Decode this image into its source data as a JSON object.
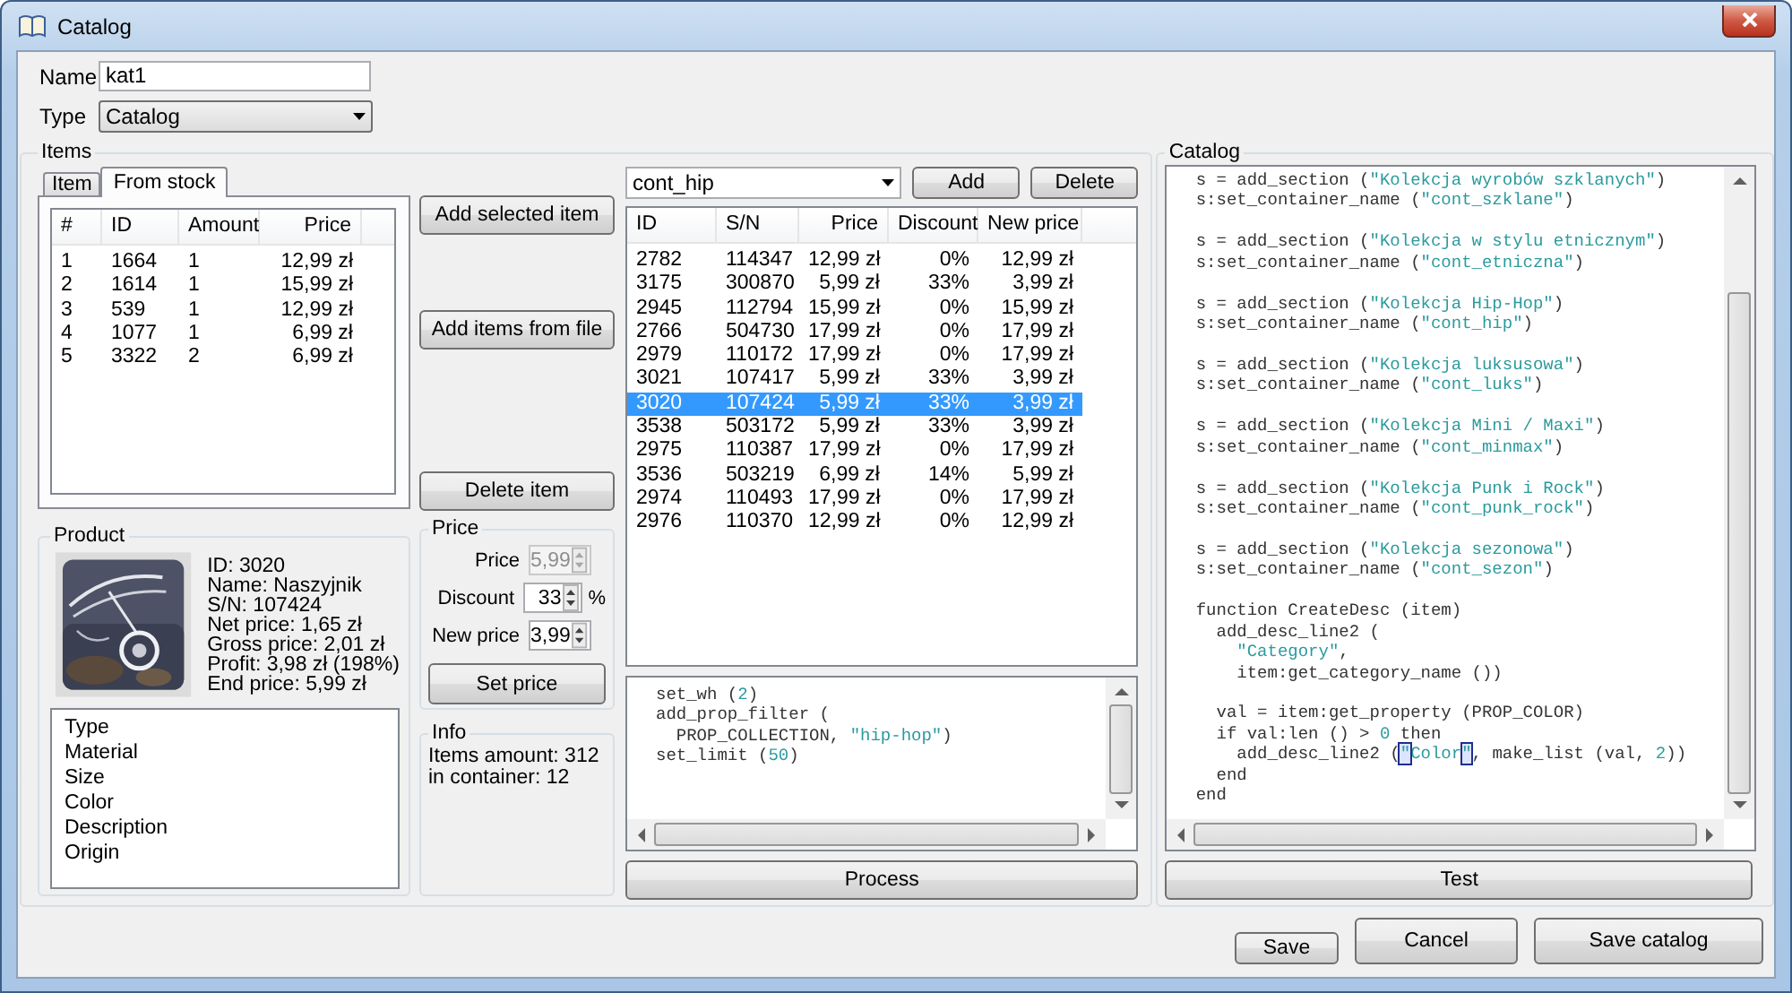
{
  "window": {
    "title": "Catalog"
  },
  "name_field": {
    "label": "Name",
    "value": "kat1"
  },
  "type_field": {
    "label": "Type",
    "value": "Catalog"
  },
  "items": {
    "title": "Items",
    "tabs": [
      {
        "label": "Item",
        "selected": false
      },
      {
        "label": "From stock",
        "selected": true
      }
    ],
    "stock_table": {
      "columns": [
        "#",
        "ID",
        "Amount",
        "Price"
      ],
      "rows": [
        [
          "1",
          "1664",
          "1",
          "12,99 zł"
        ],
        [
          "2",
          "1614",
          "1",
          "15,99 zł"
        ],
        [
          "3",
          "539",
          "1",
          "12,99 zł"
        ],
        [
          "4",
          "1077",
          "1",
          "6,99 zł"
        ],
        [
          "5",
          "3322",
          "2",
          "6,99 zł"
        ]
      ]
    },
    "buttons": [
      "Add selected item",
      "Add items from file",
      "Delete item"
    ],
    "product": {
      "title": "Product",
      "details": [
        "ID: 3020",
        "Name: Naszyjnik",
        "S/N: 107424",
        "Net price: 1,65 zł",
        "Gross price: 2,01 zł",
        "Profit: 3,98 zł (198%)",
        "End price: 5,99 zł"
      ],
      "properties": [
        "Type",
        "Material",
        "Size",
        "Color",
        "Description",
        "Origin"
      ]
    },
    "price": {
      "title": "Price",
      "fields": [
        {
          "label": "Price",
          "value": "5,99",
          "disabled": true
        },
        {
          "label": "Discount",
          "value": "33",
          "unit": "%",
          "disabled": false
        },
        {
          "label": "New price",
          "value": "3,99",
          "disabled": false
        }
      ],
      "button": "Set price"
    },
    "info": {
      "title": "Info",
      "lines": [
        "Items amount: 312",
        "in container: 12"
      ]
    },
    "container": {
      "value": "cont_hip",
      "buttons": [
        "Add",
        "Delete"
      ],
      "columns": [
        "ID",
        "S/N",
        "Price",
        "Discount",
        "New price"
      ],
      "rows": [
        {
          "cells": [
            "2782",
            "114347",
            "12,99 zł",
            "0%",
            "12,99 zł"
          ],
          "selected": false
        },
        {
          "cells": [
            "3175",
            "300870",
            "5,99 zł",
            "33%",
            "3,99 zł"
          ],
          "selected": false
        },
        {
          "cells": [
            "2945",
            "112794",
            "15,99 zł",
            "0%",
            "15,99 zł"
          ],
          "selected": false
        },
        {
          "cells": [
            "2766",
            "504730",
            "17,99 zł",
            "0%",
            "17,99 zł"
          ],
          "selected": false
        },
        {
          "cells": [
            "2979",
            "110172",
            "17,99 zł",
            "0%",
            "17,99 zł"
          ],
          "selected": false
        },
        {
          "cells": [
            "3021",
            "107417",
            "5,99 zł",
            "33%",
            "3,99 zł"
          ],
          "selected": false
        },
        {
          "cells": [
            "3020",
            "107424",
            "5,99 zł",
            "33%",
            "3,99 zł"
          ],
          "selected": true
        },
        {
          "cells": [
            "3538",
            "503172",
            "5,99 zł",
            "33%",
            "3,99 zł"
          ],
          "selected": false
        },
        {
          "cells": [
            "2975",
            "110387",
            "17,99 zł",
            "0%",
            "17,99 zł"
          ],
          "selected": false
        },
        {
          "cells": [
            "3536",
            "503219",
            "6,99 zł",
            "14%",
            "5,99 zł"
          ],
          "selected": false
        },
        {
          "cells": [
            "2974",
            "110493",
            "17,99 zł",
            "0%",
            "17,99 zł"
          ],
          "selected": false
        },
        {
          "cells": [
            "2976",
            "110370",
            "12,99 zł",
            "0%",
            "12,99 zł"
          ],
          "selected": false
        }
      ]
    },
    "filter_code": [
      {
        "kind": "code",
        "segments": [
          {
            "kind": "plain",
            "text": "set_wh ("
          },
          {
            "kind": "number",
            "text": "2"
          },
          {
            "kind": "plain",
            "text": ")"
          }
        ]
      },
      {
        "kind": "code",
        "segments": [
          {
            "kind": "plain",
            "text": "add_prop_filter ("
          }
        ]
      },
      {
        "kind": "code",
        "segments": [
          {
            "kind": "plain",
            "text": "  PROP_COLLECTION, "
          },
          {
            "kind": "string",
            "text": "\"hip-hop\""
          },
          {
            "kind": "plain",
            "text": ")"
          }
        ]
      },
      {
        "kind": "code",
        "segments": [
          {
            "kind": "plain",
            "text": "set_limit ("
          },
          {
            "kind": "number",
            "text": "50"
          },
          {
            "kind": "plain",
            "text": ")"
          }
        ]
      }
    ],
    "process_button": "Process"
  },
  "catalog": {
    "title": "Catalog",
    "code": [
      {
        "kind": "code",
        "segments": [
          {
            "kind": "plain",
            "text": "s = add_section ("
          },
          {
            "kind": "string",
            "text": "\"Kolekcja wyrobów szklanych\""
          },
          {
            "kind": "plain",
            "text": ")"
          }
        ]
      },
      {
        "kind": "code",
        "segments": [
          {
            "kind": "plain",
            "text": "s:set_container_name ("
          },
          {
            "kind": "string",
            "text": "\"cont_szklane\""
          },
          {
            "kind": "plain",
            "text": ")"
          }
        ]
      },
      {
        "kind": "blank"
      },
      {
        "kind": "code",
        "segments": [
          {
            "kind": "plain",
            "text": "s = add_section ("
          },
          {
            "kind": "string",
            "text": "\"Kolekcja w stylu etnicznym\""
          },
          {
            "kind": "plain",
            "text": ")"
          }
        ]
      },
      {
        "kind": "code",
        "segments": [
          {
            "kind": "plain",
            "text": "s:set_container_name ("
          },
          {
            "kind": "string",
            "text": "\"cont_etniczna\""
          },
          {
            "kind": "plain",
            "text": ")"
          }
        ]
      },
      {
        "kind": "blank"
      },
      {
        "kind": "code",
        "segments": [
          {
            "kind": "plain",
            "text": "s = add_section ("
          },
          {
            "kind": "string",
            "text": "\"Kolekcja Hip-Hop\""
          },
          {
            "kind": "plain",
            "text": ")"
          }
        ]
      },
      {
        "kind": "code",
        "segments": [
          {
            "kind": "plain",
            "text": "s:set_container_name ("
          },
          {
            "kind": "string",
            "text": "\"cont_hip\""
          },
          {
            "kind": "plain",
            "text": ")"
          }
        ]
      },
      {
        "kind": "blank"
      },
      {
        "kind": "code",
        "segments": [
          {
            "kind": "plain",
            "text": "s = add_section ("
          },
          {
            "kind": "string",
            "text": "\"Kolekcja luksusowa\""
          },
          {
            "kind": "plain",
            "text": ")"
          }
        ]
      },
      {
        "kind": "code",
        "segments": [
          {
            "kind": "plain",
            "text": "s:set_container_name ("
          },
          {
            "kind": "string",
            "text": "\"cont_luks\""
          },
          {
            "kind": "plain",
            "text": ")"
          }
        ]
      },
      {
        "kind": "blank"
      },
      {
        "kind": "code",
        "segments": [
          {
            "kind": "plain",
            "text": "s = add_section ("
          },
          {
            "kind": "string",
            "text": "\"Kolekcja Mini / Maxi\""
          },
          {
            "kind": "plain",
            "text": ")"
          }
        ]
      },
      {
        "kind": "code",
        "segments": [
          {
            "kind": "plain",
            "text": "s:set_container_name ("
          },
          {
            "kind": "string",
            "text": "\"cont_minmax\""
          },
          {
            "kind": "plain",
            "text": ")"
          }
        ]
      },
      {
        "kind": "blank"
      },
      {
        "kind": "code",
        "segments": [
          {
            "kind": "plain",
            "text": "s = add_section ("
          },
          {
            "kind": "string",
            "text": "\"Kolekcja Punk i Rock\""
          },
          {
            "kind": "plain",
            "text": ")"
          }
        ]
      },
      {
        "kind": "code",
        "segments": [
          {
            "kind": "plain",
            "text": "s:set_container_name ("
          },
          {
            "kind": "string",
            "text": "\"cont_punk_rock\""
          },
          {
            "kind": "plain",
            "text": ")"
          }
        ]
      },
      {
        "kind": "blank"
      },
      {
        "kind": "code",
        "segments": [
          {
            "kind": "plain",
            "text": "s = add_section ("
          },
          {
            "kind": "string",
            "text": "\"Kolekcja sezonowa\""
          },
          {
            "kind": "plain",
            "text": ")"
          }
        ]
      },
      {
        "kind": "code",
        "segments": [
          {
            "kind": "plain",
            "text": "s:set_container_name ("
          },
          {
            "kind": "string",
            "text": "\"cont_sezon\""
          },
          {
            "kind": "plain",
            "text": ")"
          }
        ]
      },
      {
        "kind": "blank"
      },
      {
        "kind": "code",
        "segments": [
          {
            "kind": "plain",
            "text": "function CreateDesc (item)"
          }
        ]
      },
      {
        "kind": "code",
        "segments": [
          {
            "kind": "plain",
            "text": "  add_desc_line2 ("
          }
        ]
      },
      {
        "kind": "code",
        "segments": [
          {
            "kind": "string",
            "text": "    \"Category\""
          },
          {
            "kind": "plain",
            "text": ","
          }
        ]
      },
      {
        "kind": "code",
        "segments": [
          {
            "kind": "plain",
            "text": "    item:get_category_name ())"
          }
        ]
      },
      {
        "kind": "blank"
      },
      {
        "kind": "code",
        "segments": [
          {
            "kind": "plain",
            "text": "  val = item:get_property (PROP_COLOR)"
          }
        ]
      },
      {
        "kind": "code",
        "segments": [
          {
            "kind": "plain",
            "text": "  if val:len () > "
          },
          {
            "kind": "number",
            "text": "0"
          },
          {
            "kind": "plain",
            "text": " then"
          }
        ]
      },
      {
        "kind": "code",
        "segments": [
          {
            "kind": "plain",
            "text": "    add_desc_line2 ("
          },
          {
            "kind": "match",
            "text": "\""
          },
          {
            "kind": "string",
            "text": "Color"
          },
          {
            "kind": "match",
            "text": "\""
          },
          {
            "kind": "plain",
            "text": ", make_list (val, "
          },
          {
            "kind": "number",
            "text": "2"
          },
          {
            "kind": "plain",
            "text": "))"
          }
        ]
      },
      {
        "kind": "code",
        "segments": [
          {
            "kind": "plain",
            "text": "  end"
          }
        ]
      },
      {
        "kind": "code",
        "segments": [
          {
            "kind": "plain",
            "text": "end"
          }
        ]
      }
    ],
    "test_button": "Test"
  },
  "footer_buttons": [
    "Save",
    "Cancel",
    "Save catalog"
  ]
}
